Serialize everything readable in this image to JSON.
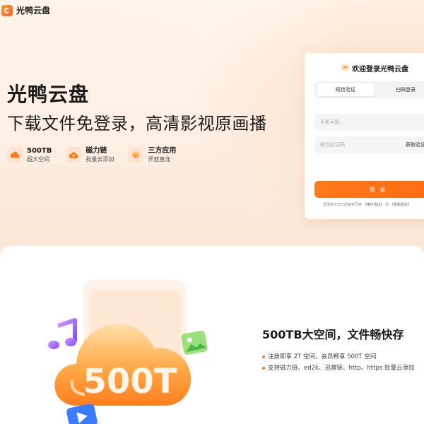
{
  "header": {
    "logo_text": "光鸭云盘"
  },
  "hero": {
    "title": "光鸭云盘",
    "subtitle": "下载文件免登录，高清影视原画播"
  },
  "features": [
    {
      "title": "500TB",
      "desc": "超大空间",
      "icon": "cloud-icon"
    },
    {
      "title": "磁力链",
      "desc": "批量云添加",
      "icon": "cloud-upload-icon"
    },
    {
      "title": "三方应用",
      "desc": "开放直连",
      "icon": "box-icon"
    }
  ],
  "login": {
    "heading": "欢迎登录光鸭云盘",
    "tabs": [
      "短信验证",
      "扫码登录"
    ],
    "phone_placeholder": "手机号码",
    "code_placeholder": "短信验证码",
    "get_code": "获取验证",
    "submit": "登 录",
    "agreement_prefix": "登录表示您已阅读并同意",
    "user_agreement": "《用户协议》",
    "and": "和",
    "privacy": "《隐私协议》"
  },
  "section2": {
    "badge_text": "500T",
    "title": "500TB大空间，文件畅快存",
    "bullets": [
      "注册即享 2T 空间，会员畅享 500T 空间",
      "支持磁力链、ed2k、迅雷链、http、https 批量云添加"
    ]
  },
  "colors": {
    "accent": "#ff6a10",
    "hero_bg": "#fdeee3",
    "icon_bg": "#fde3d0"
  }
}
